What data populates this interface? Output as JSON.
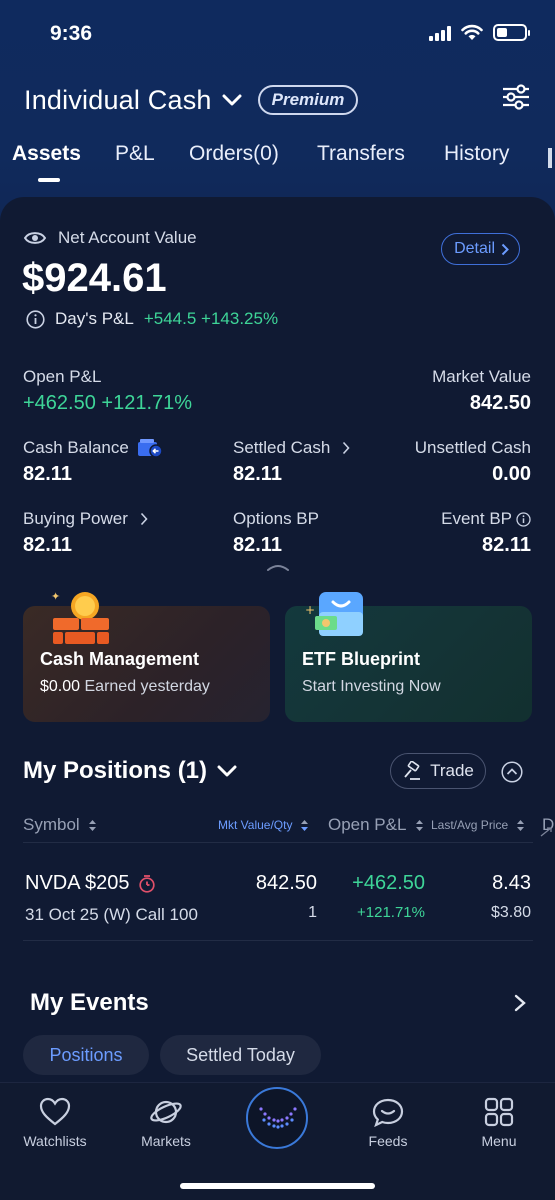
{
  "status_bar": {
    "time": "9:36"
  },
  "header": {
    "account_title": "Individual Cash",
    "premium_badge": "Premium"
  },
  "tabs": [
    {
      "label": "Assets",
      "active": true
    },
    {
      "label": "P&L"
    },
    {
      "label": "Orders(0)"
    },
    {
      "label": "Transfers"
    },
    {
      "label": "History"
    }
  ],
  "account": {
    "net_label": "Net Account Value",
    "net_value": "$924.61",
    "detail_label": "Detail",
    "days_pl_label": "Day's P&L",
    "days_pl_value": "+544.5 +143.25%"
  },
  "metrics": {
    "open_pl_label": "Open P&L",
    "open_pl_value": "+462.50 +121.71%",
    "market_value_label": "Market Value",
    "market_value": "842.50",
    "cash_balance_label": "Cash Balance",
    "cash_balance": "82.11",
    "settled_cash_label": "Settled Cash",
    "settled_cash": "82.11",
    "unsettled_cash_label": "Unsettled Cash",
    "unsettled_cash": "0.00",
    "buying_power_label": "Buying Power",
    "buying_power": "82.11",
    "options_bp_label": "Options BP",
    "options_bp": "82.11",
    "event_bp_label": "Event BP",
    "event_bp": "82.11"
  },
  "promos": [
    {
      "title": "Cash Management",
      "amount": "$0.00",
      "subtitle": "Earned yesterday"
    },
    {
      "title": "ETF Blueprint",
      "subtitle": "Start Investing Now"
    }
  ],
  "positions": {
    "title": "My Positions (1)",
    "trade_label": "Trade",
    "headers": {
      "symbol": "Symbol",
      "mkt_value_qty": "Mkt Value/Qty",
      "open_pl": "Open P&L",
      "last_avg_price": "Last/Avg Price"
    },
    "rows": [
      {
        "symbol": "NVDA $205",
        "contract": "31 Oct 25 (W) Call 100",
        "mkt_value": "842.50",
        "qty": "1",
        "open_pl": "+462.50",
        "open_pl_pct": "+121.71%",
        "last_price": "8.43",
        "avg_price": "$3.80"
      }
    ]
  },
  "events": {
    "title": "My Events",
    "chips": [
      "Positions",
      "Settled Today"
    ]
  },
  "bottom_nav": [
    {
      "label": "Watchlists",
      "icon": "heart-icon"
    },
    {
      "label": "Markets",
      "icon": "planet-icon"
    },
    {
      "label": "",
      "icon": "home-logo-icon"
    },
    {
      "label": "Feeds",
      "icon": "chat-icon"
    },
    {
      "label": "Menu",
      "icon": "grid-icon"
    }
  ],
  "colors": {
    "accent_green": "#3ed598",
    "accent_blue": "#6c9cff",
    "alert_red": "#e0506a",
    "panel_bg": "#101a33",
    "header_bg": "#0f2a5e"
  }
}
